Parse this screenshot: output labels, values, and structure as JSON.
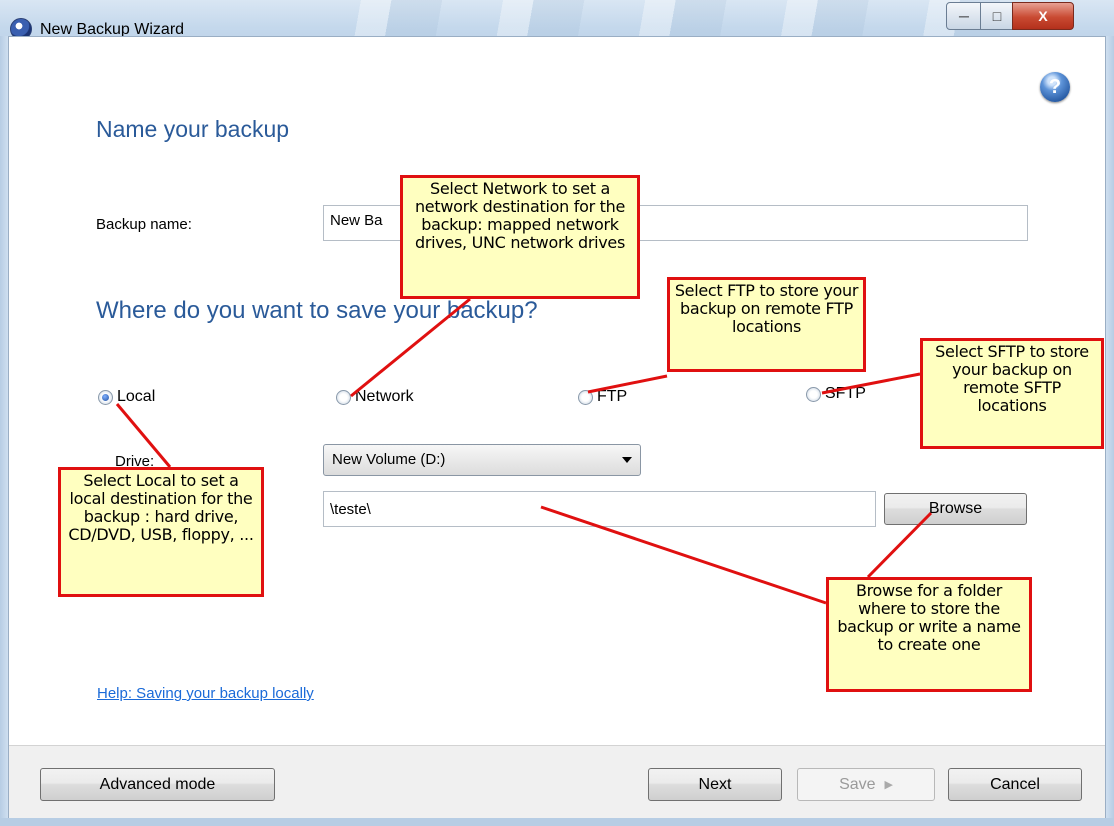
{
  "window": {
    "title": "New Backup Wizard",
    "minimize_glyph": "─",
    "maximize_glyph": "□",
    "close_glyph": "X",
    "help_glyph": "?"
  },
  "main": {
    "heading_name": "Name your backup",
    "backup_name_label": "Backup name:",
    "backup_name_value": "New Ba",
    "heading_where": "Where do you want to save your backup?",
    "destinations": [
      {
        "label": "Local",
        "selected": true
      },
      {
        "label": "Network",
        "selected": false
      },
      {
        "label": "FTP",
        "selected": false
      },
      {
        "label": "SFTP",
        "selected": false
      }
    ],
    "drive_label": "Drive:",
    "drive_value": "New Volume (D:)",
    "path_value": "\\teste\\",
    "browse_label": "Browse",
    "help_link": "Help: Saving your backup locally"
  },
  "footer": {
    "advanced_label": "Advanced mode",
    "next_label": "Next",
    "save_label": "Save",
    "save_arrow": "▶",
    "cancel_label": "Cancel"
  },
  "callouts": {
    "network": "Select Network to set a network destination for the backup: mapped network drives, UNC network drives",
    "ftp": "Select FTP to store your backup on remote FTP locations",
    "sftp": "Select SFTP to store your backup on remote SFTP locations",
    "local": "Select Local to set a local destination for the backup : hard drive, CD/DVD, USB, floppy, ...",
    "browse": "Browse for a folder where to store the backup or write a name to create one"
  },
  "colors": {
    "heading": "#2a5a99",
    "callout_border": "#e01010",
    "callout_fill": "#ffffc0",
    "link": "#1a6ad8"
  }
}
